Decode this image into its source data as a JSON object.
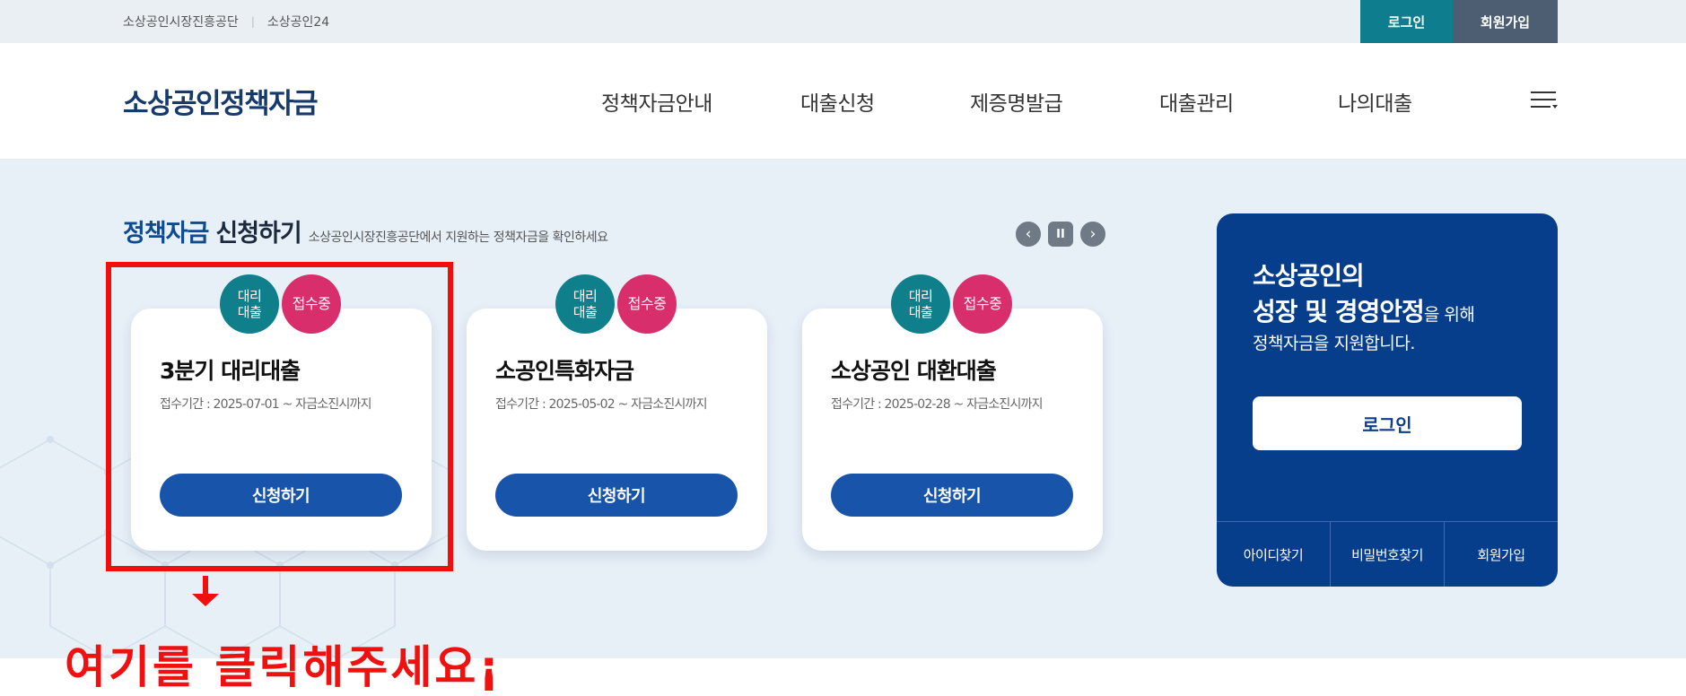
{
  "utility": {
    "links": [
      "소상공인시장진흥공단",
      "소상공인24"
    ],
    "separator": "|",
    "login": "로그인",
    "join": "회원가입"
  },
  "header": {
    "logo": "소상공인정책자금",
    "nav": [
      "정책자금안내",
      "대출신청",
      "제증명발급",
      "대출관리",
      "나의대출"
    ],
    "menu_icon": "hamburger-menu-icon"
  },
  "section": {
    "title_accent": "정책자금",
    "title_main": "신청하기",
    "description": "소상공인시장진흥공단에서 지원하는 정책자금을 확인하세요",
    "controls": {
      "prev": "‹",
      "pause": "II",
      "next": "›"
    }
  },
  "cards": [
    {
      "badge_type": "대리\n대출",
      "badge_status": "접수중",
      "title": "3분기 대리대출",
      "period": "접수기간 : 2025-07-01 ~ 자금소진시까지",
      "button": "신청하기"
    },
    {
      "badge_type": "대리\n대출",
      "badge_status": "접수중",
      "title": "소공인특화자금",
      "period": "접수기간 : 2025-05-02 ~ 자금소진시까지",
      "button": "신청하기"
    },
    {
      "badge_type": "대리\n대출",
      "badge_status": "접수중",
      "title": "소상공인 대환대출",
      "period": "접수기간 : 2025-02-28 ~ 자금소진시까지",
      "button": "신청하기"
    }
  ],
  "panel": {
    "line1": "소상공인의",
    "line2_strong": "성장 및 경영안정",
    "line2_normal": "을 위해",
    "line3": "정책자금을 지원합니다.",
    "login": "로그인",
    "links": [
      "아이디찾기",
      "비밀번호찾기",
      "회원가입"
    ]
  },
  "annotation": {
    "text": "여기를 클릭해주세요¡",
    "color": "#f01010"
  },
  "colors": {
    "brand": "#073e8c",
    "button": "#1854aa",
    "badge_agent": "#0f7f8c",
    "badge_open": "#d92e6c",
    "utility_login": "#0e7e8e",
    "utility_join": "#4d5e72"
  }
}
